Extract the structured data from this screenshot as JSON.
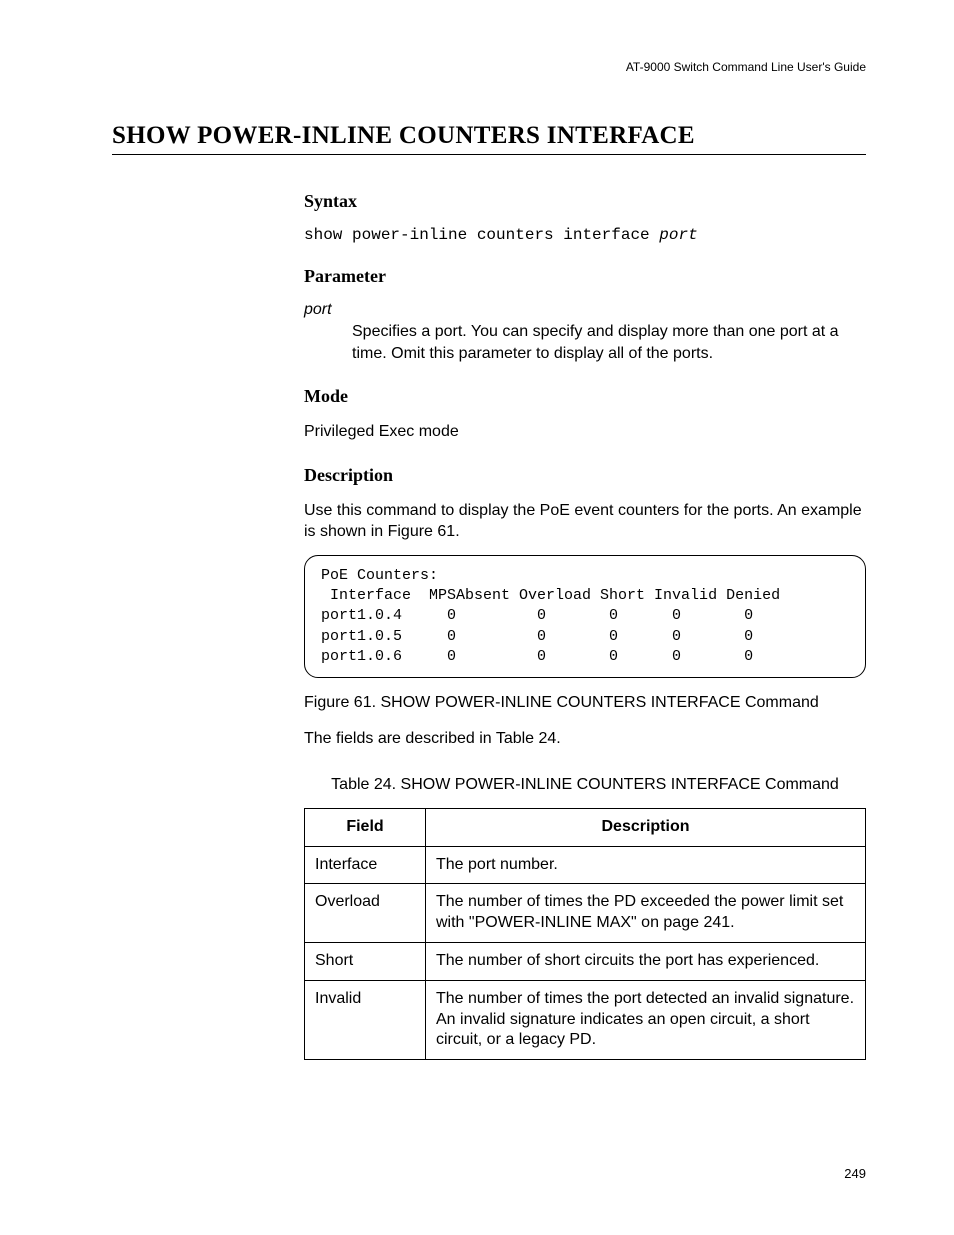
{
  "header": "AT-9000 Switch Command Line User's Guide",
  "title": "SHOW POWER-INLINE COUNTERS INTERFACE",
  "sections": {
    "syntax": {
      "heading": "Syntax",
      "command": "show power-inline counters interface ",
      "arg": "port"
    },
    "parameter": {
      "heading": "Parameter",
      "name": "port",
      "desc": "Specifies a port. You can specify and display more than one port at a time. Omit this parameter to display all of the ports."
    },
    "mode": {
      "heading": "Mode",
      "text": "Privileged Exec mode"
    },
    "description": {
      "heading": "Description",
      "intro": "Use this command to display the PoE event counters for the ports. An example is shown in Figure 61.",
      "figure_caption": "Figure 61. SHOW POWER-INLINE COUNTERS INTERFACE Command",
      "after_fig": "The fields are described in Table 24.",
      "table_caption": "Table 24. SHOW POWER-INLINE COUNTERS INTERFACE Command"
    }
  },
  "output_box": {
    "title": "PoE Counters:",
    "header": " Interface  MPSAbsent Overload Short Invalid Denied",
    "rows": [
      "port1.0.4     0         0       0      0       0",
      "port1.0.5     0         0       0      0       0",
      "port1.0.6     0         0       0      0       0"
    ]
  },
  "table": {
    "head_field": "Field",
    "head_desc": "Description",
    "rows": [
      {
        "field": "Interface",
        "desc": "The port number."
      },
      {
        "field": "Overload",
        "desc": "The number of times the PD exceeded the power limit set with \"POWER-INLINE MAX\" on page 241."
      },
      {
        "field": "Short",
        "desc": "The number of short circuits the port has experienced."
      },
      {
        "field": "Invalid",
        "desc": "The number of times the port detected an invalid signature. An invalid signature indicates an open circuit, a short circuit, or a legacy PD."
      }
    ]
  },
  "page_number": "249"
}
